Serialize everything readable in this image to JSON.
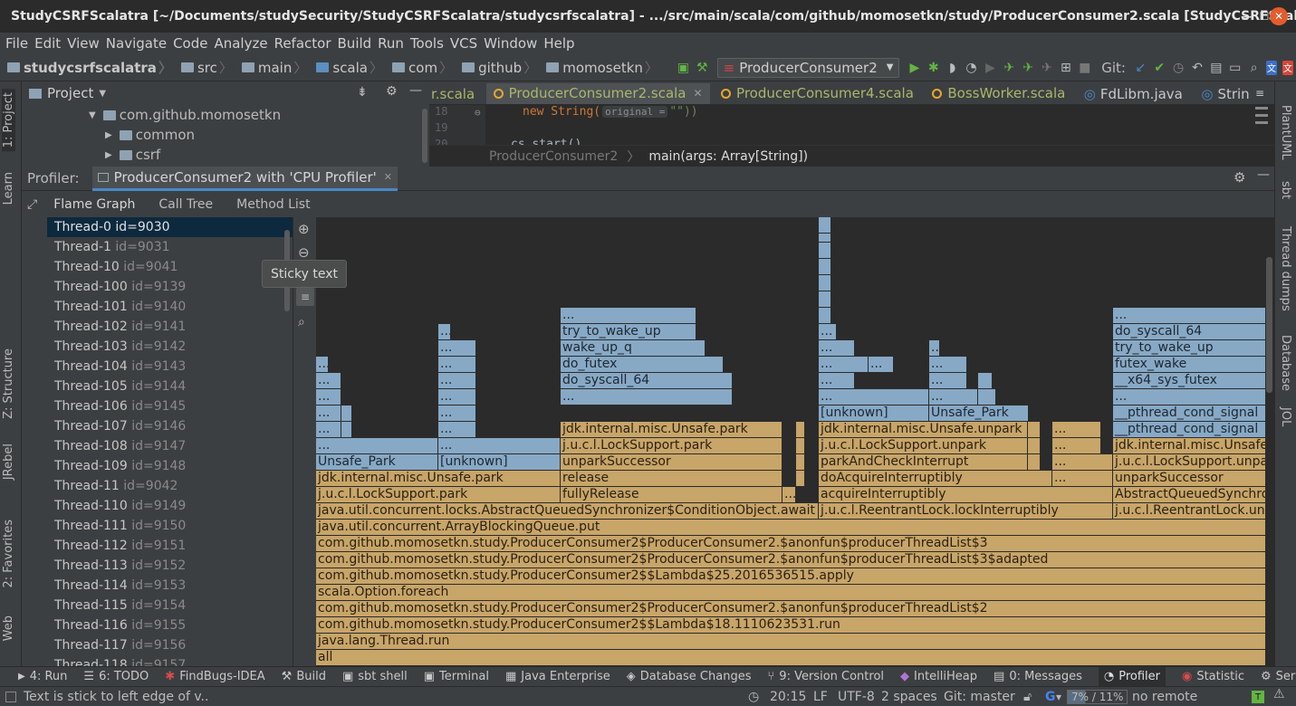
{
  "title": "StudyCSRFScalatra [~/Documents/studySecurity/StudyCSRFScalatra/studycsrfscalatra] - .../src/main/scala/com/github/momosetkn/study/ProducerConsumer2.scala [StudyCSRFScalatra]",
  "menu": [
    "File",
    "Edit",
    "View",
    "Navigate",
    "Code",
    "Analyze",
    "Refactor",
    "Build",
    "Run",
    "Tools",
    "VCS",
    "Window",
    "Help"
  ],
  "breadcrumbs": [
    "studycsrfscalatra",
    "src",
    "main",
    "scala",
    "com",
    "github",
    "momosetkn"
  ],
  "run_config": "ProducerConsumer2",
  "git_label": "Git:",
  "left_tools": [
    "1: Project",
    "Learn",
    "Z: Structure",
    "JRebel",
    "2: Favorites",
    "Web"
  ],
  "right_tools": [
    "PlantUML",
    "sbt",
    "Thread dumps",
    "Database",
    "JOL"
  ],
  "project_panel": {
    "title": "Project",
    "tree": [
      "com.github.momosetkn",
      "common",
      "csrf"
    ]
  },
  "editor_tabs": [
    "r.scala",
    "ProducerConsumer2.scala",
    "ProducerConsumer4.scala",
    "BossWorker.scala",
    "FdLibm.java",
    "Strin"
  ],
  "editor": {
    "line_numbers": [
      "18",
      "19",
      "20"
    ],
    "code_pre": "new String(",
    "hint": "original =",
    "code_post": "\"\"))",
    "code_line3": "cs.start()",
    "breadcrumb_class": "ProducerConsumer2",
    "breadcrumb_method": "main(args: Array[String])"
  },
  "profiler": {
    "label": "Profiler:",
    "session": "ProducerConsumer2 with 'CPU Profiler'",
    "tabs": [
      "Flame Graph",
      "Call Tree",
      "Method List"
    ],
    "tooltip": "Sticky text"
  },
  "threads": [
    {
      "name": "Thread-0",
      "id": "id=9030"
    },
    {
      "name": "Thread-1",
      "id": "id=9031"
    },
    {
      "name": "Thread-10",
      "id": "id=9041"
    },
    {
      "name": "Thread-100",
      "id": "id=9139"
    },
    {
      "name": "Thread-101",
      "id": "id=9140"
    },
    {
      "name": "Thread-102",
      "id": "id=9141"
    },
    {
      "name": "Thread-103",
      "id": "id=9142"
    },
    {
      "name": "Thread-104",
      "id": "id=9143"
    },
    {
      "name": "Thread-105",
      "id": "id=9144"
    },
    {
      "name": "Thread-106",
      "id": "id=9145"
    },
    {
      "name": "Thread-107",
      "id": "id=9146"
    },
    {
      "name": "Thread-108",
      "id": "id=9147"
    },
    {
      "name": "Thread-109",
      "id": "id=9148"
    },
    {
      "name": "Thread-11",
      "id": "id=9042"
    },
    {
      "name": "Thread-110",
      "id": "id=9149"
    },
    {
      "name": "Thread-111",
      "id": "id=9150"
    },
    {
      "name": "Thread-112",
      "id": "id=9151"
    },
    {
      "name": "Thread-113",
      "id": "id=9152"
    },
    {
      "name": "Thread-114",
      "id": "id=9153"
    },
    {
      "name": "Thread-115",
      "id": "id=9154"
    },
    {
      "name": "Thread-116",
      "id": "id=9155"
    },
    {
      "name": "Thread-117",
      "id": "id=9156"
    },
    {
      "name": "Thread-118",
      "id": "id=9157"
    }
  ],
  "frames": [
    "all",
    "java.lang.Thread.run",
    "com.github.momosetkn.study.ProducerConsumer2$$Lambda$18.1110623531.run",
    "com.github.momosetkn.study.ProducerConsumer2$ProducerConsumer2.$anonfun$producerThreadList$2",
    "scala.Option.foreach",
    "com.github.momosetkn.study.ProducerConsumer2$$Lambda$25.2016536515.apply",
    "com.github.momosetkn.study.ProducerConsumer2$ProducerConsumer2.$anonfun$producerThreadList$3$adapted",
    "com.github.momosetkn.study.ProducerConsumer2$ProducerConsumer2.$anonfun$producerThreadList$3",
    "java.util.concurrent.ArrayBlockingQueue.put",
    "java.util.concurrent.locks.AbstractQueuedSynchronizer$ConditionObject.await",
    "j.u.c.l.ReentrantLock.lockInterruptibly",
    "j.u.c.l.ReentrantLock.unlo",
    "j.u.c.l.LockSupport.park",
    "fullyRelease",
    "...",
    "acquireInterruptibly",
    "AbstractQueuedSynchron",
    "jdk.internal.misc.Unsafe.park",
    "release",
    "doAcquireInterruptibly",
    "unparkSuccessor",
    "Unsafe_Park",
    "[unknown]",
    "unparkSuccessor",
    "parkAndCheckInterrupt",
    "j.u.c.l.LockSupport.unpark",
    "j.u.c.l.LockSupport.park",
    "j.u.c.l.LockSupport.unpark",
    "jdk.internal.misc.Unsafe.unpark",
    "jdk.internal.misc.Unsafe.park",
    "jdk.internal.misc.Unsafe.unpark",
    "__pthread_cond_signal",
    "[unknown]",
    "Unsafe_Park",
    "__pthread_cond_signal",
    "do_syscall_64",
    "__x64_sys_futex",
    "do_futex",
    "futex_wake",
    "wake_up_q",
    "try_to_wake_up",
    "do_syscall_64",
    "__x64_sys_futex",
    "do_futex",
    "futex_wake",
    "wake_up_q",
    "try_to_wake_up"
  ],
  "bottom_tools": [
    "4: Run",
    "6: TODO",
    "FindBugs-IDEA",
    "Build",
    "sbt shell",
    "Terminal",
    "Java Enterprise",
    "Database Changes",
    "9: Version Control",
    "IntelliHeap",
    "0: Messages",
    "Profiler",
    "Statistic",
    "Serv"
  ],
  "status": {
    "message": "Text is stick to left edge of v..",
    "position": "20:15",
    "line_sep": "LF",
    "encoding": "UTF-8",
    "indent": "2 spaces",
    "vcs": "Git: master",
    "memory": "7% / 11%",
    "remote": "no remote"
  },
  "colors": {
    "frame_blue": "#87a9c6",
    "frame_orange": "#c8a568",
    "selection": "#0d293e",
    "accent": "#4a88c7"
  }
}
